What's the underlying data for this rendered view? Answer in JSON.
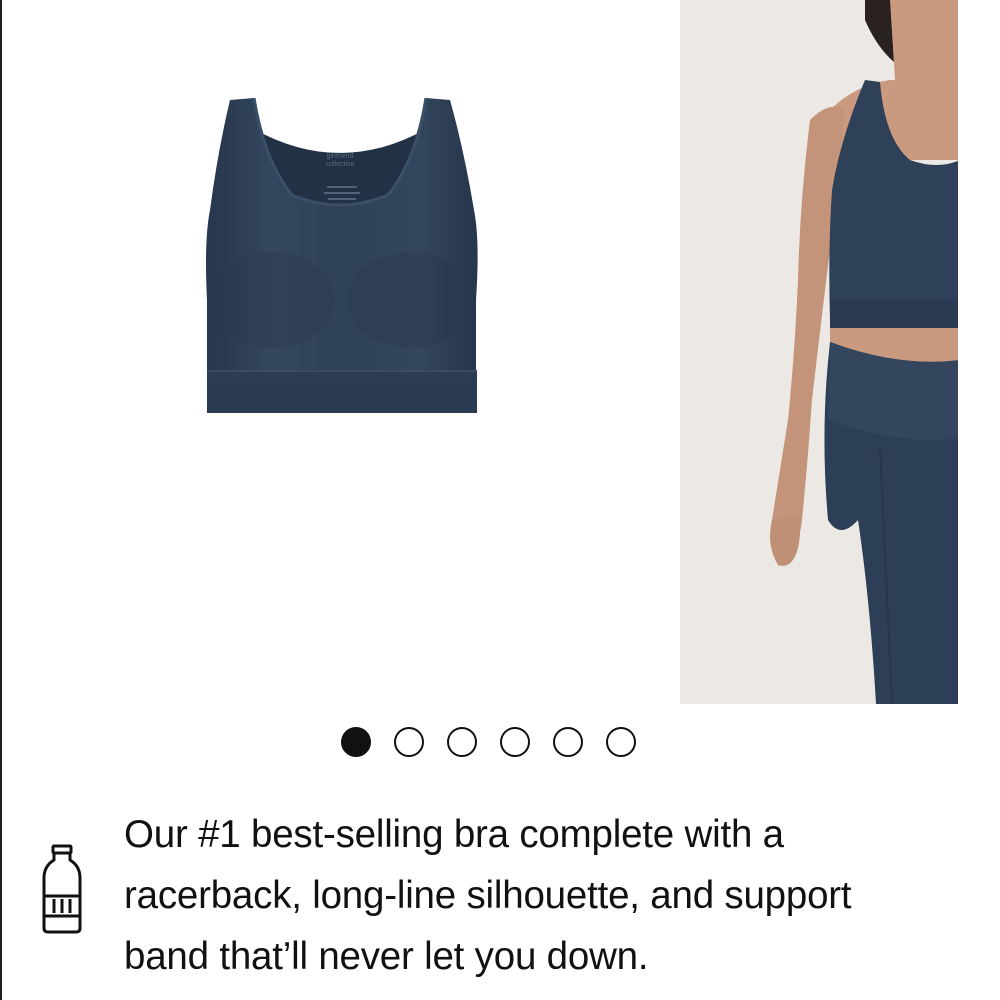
{
  "gallery": {
    "slides": [
      {
        "label": "product-flat",
        "brand_tag": "girlfriend collective"
      },
      {
        "label": "model-wearing"
      }
    ],
    "pagination": {
      "total": 6,
      "active": 1
    }
  },
  "description": {
    "icon": "water-bottle-icon",
    "text": "Our #1 best-selling bra complete with a racerback, long-line silhouette, and support band that’ll never let you down."
  },
  "colors": {
    "garment": "#2e4058",
    "background": "#ffffff",
    "model_bg": "#ece8e3",
    "text": "#111111"
  }
}
